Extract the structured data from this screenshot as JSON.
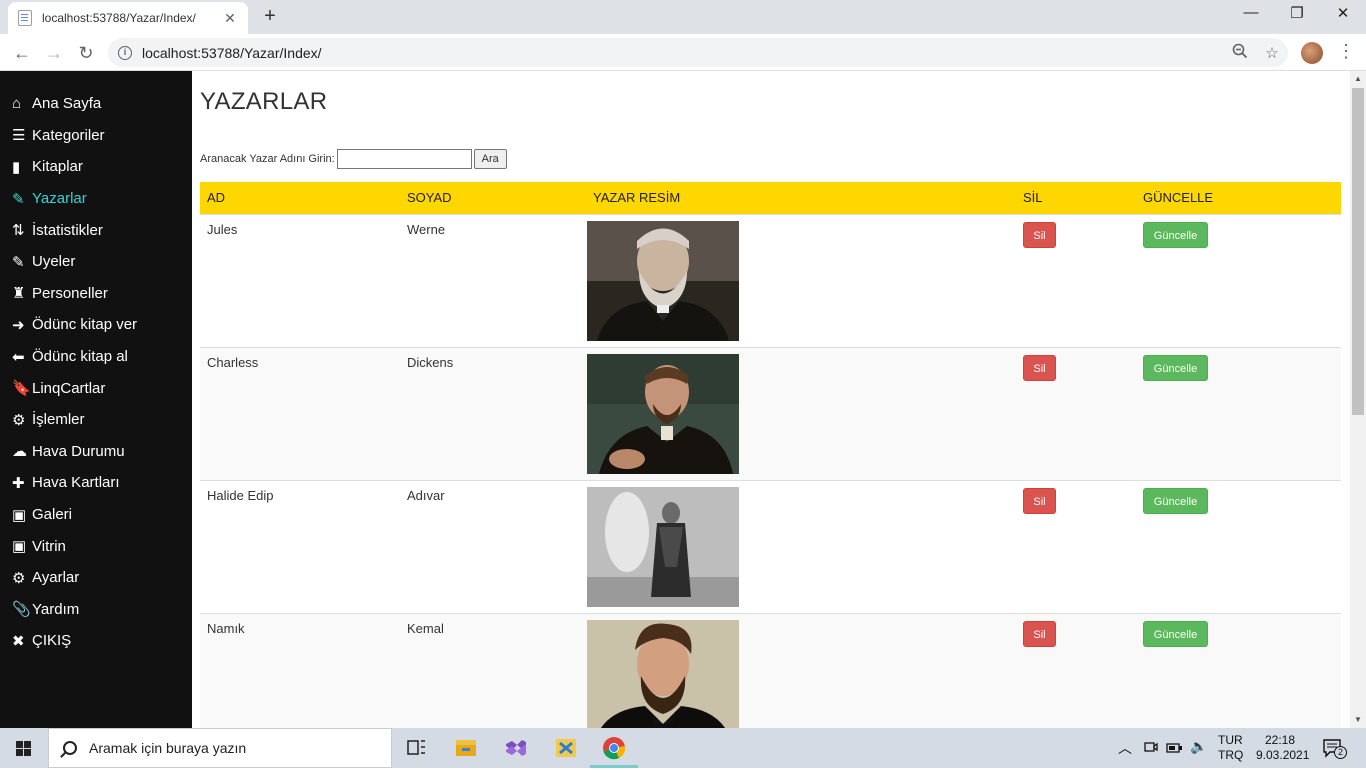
{
  "browser": {
    "tab_title": "localhost:53788/Yazar/Index/",
    "url": "localhost:53788/Yazar/Index/",
    "new_tab": "+",
    "close_tab": "✕",
    "window_min": "—",
    "window_restore": "❐",
    "window_close": "✕",
    "back": "←",
    "forward": "→",
    "reload": "↻",
    "menu": "⋮"
  },
  "sidebar": {
    "items": [
      {
        "label": "Ana Sayfa",
        "icon": "⌂"
      },
      {
        "label": "Kategoriler",
        "icon": "☰"
      },
      {
        "label": "Kitaplar",
        "icon": "▮"
      },
      {
        "label": "Yazarlar",
        "icon": "✎"
      },
      {
        "label": "İstatistikler",
        "icon": "⇅"
      },
      {
        "label": "Uyeler",
        "icon": "✎"
      },
      {
        "label": "Personeller",
        "icon": "♜"
      },
      {
        "label": "Ödünc kitap ver",
        "icon": "➜"
      },
      {
        "label": "Ödünc kitap al",
        "icon": "⬅"
      },
      {
        "label": "LinqCartlar",
        "icon": "🔖"
      },
      {
        "label": "İşlemler",
        "icon": "⚙"
      },
      {
        "label": "Hava Durumu",
        "icon": "☁"
      },
      {
        "label": "Hava Kartları",
        "icon": "✚"
      },
      {
        "label": "Galeri",
        "icon": "▣"
      },
      {
        "label": "Vitrin",
        "icon": "▣"
      },
      {
        "label": "Ayarlar",
        "icon": "⚙"
      },
      {
        "label": "Yardım",
        "icon": "📎"
      },
      {
        "label": "ÇIKIŞ",
        "icon": "✖"
      }
    ],
    "active_index": 3,
    "active_color": "#34d3d3"
  },
  "page": {
    "title": "YAZARLAR",
    "search_label": "Aranacak Yazar Adını Girin:",
    "search_value": "",
    "search_button": "Ara"
  },
  "table": {
    "header_color": "#ffd700",
    "columns": [
      "AD",
      "SOYAD",
      "YAZAR RESİM",
      "SİL",
      "GÜNCELLE"
    ],
    "rows": [
      {
        "ad": "Jules",
        "soyad": "Werne",
        "sil": "Sil",
        "guncelle": "Güncelle"
      },
      {
        "ad": "Charless",
        "soyad": "Dickens",
        "sil": "Sil",
        "guncelle": "Güncelle"
      },
      {
        "ad": "Halide Edip",
        "soyad": "Adıvar",
        "sil": "Sil",
        "guncelle": "Güncelle"
      },
      {
        "ad": "Namık",
        "soyad": "Kemal",
        "sil": "Sil",
        "guncelle": "Güncelle"
      }
    ]
  },
  "taskbar": {
    "search_placeholder": "Aramak için buraya yazın",
    "lang_top": "TUR",
    "lang_bottom": "TRQ",
    "time": "22:18",
    "date": "9.03.2021",
    "notifications": "2"
  }
}
